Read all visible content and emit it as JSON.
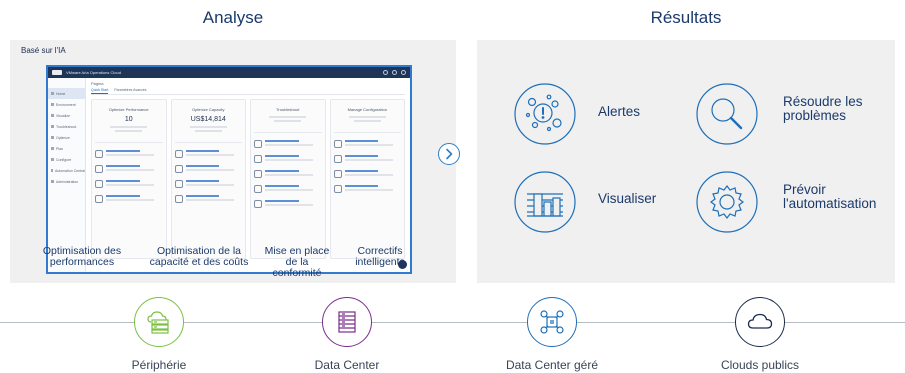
{
  "analysis": {
    "title": "Analyse",
    "tag": "Basé sur l'IA",
    "app": {
      "window_title": "VMware Aria Operations Cloud",
      "breadcrumb": "Página",
      "tabs": [
        "Quick Start",
        "Paramètres Avancés"
      ],
      "sidebar": [
        "Home",
        "Environment",
        "Visualize",
        "Troubleshoot",
        "Optimize",
        "Plan",
        "Configure",
        "Automation Central",
        "Administration"
      ],
      "cards": [
        {
          "title": "Optimize Performance",
          "big": "10"
        },
        {
          "title": "Optimize Capacity",
          "big": "US$14,814"
        },
        {
          "title": "Troubleshoot",
          "big": ""
        },
        {
          "title": "Manage Configuration",
          "big": ""
        }
      ]
    },
    "captions": [
      "Optimisation des performances",
      "Optimisation de la capacité et des coûts",
      "Mise en place de la conformité",
      "Correctifs intelligents"
    ]
  },
  "results": {
    "title": "Résultats",
    "items": [
      {
        "icon": "alerts-icon",
        "label": "Alertes"
      },
      {
        "icon": "magnifier-icon",
        "label": "Résoudre les problèmes"
      },
      {
        "icon": "bar-chart-icon",
        "label": "Visualiser"
      },
      {
        "icon": "gear-automation-icon",
        "label": "Prévoir l'automatisation"
      }
    ]
  },
  "deployment": [
    {
      "icon": "edge-cloud-icon",
      "label": "Périphérie",
      "color": "#7ac143"
    },
    {
      "icon": "datacenter-icon",
      "label": "Data Center",
      "color": "#7a2e8e"
    },
    {
      "icon": "managed-datacenter-icon",
      "label": "Data Center géré",
      "color": "#1f6fb8"
    },
    {
      "icon": "cloud-icon",
      "label": "Clouds publics",
      "color": "#1a2c4c"
    }
  ],
  "colors": {
    "accent": "#2f7fc8",
    "panel": "#f0f0f0",
    "text": "#1b3a6b"
  }
}
